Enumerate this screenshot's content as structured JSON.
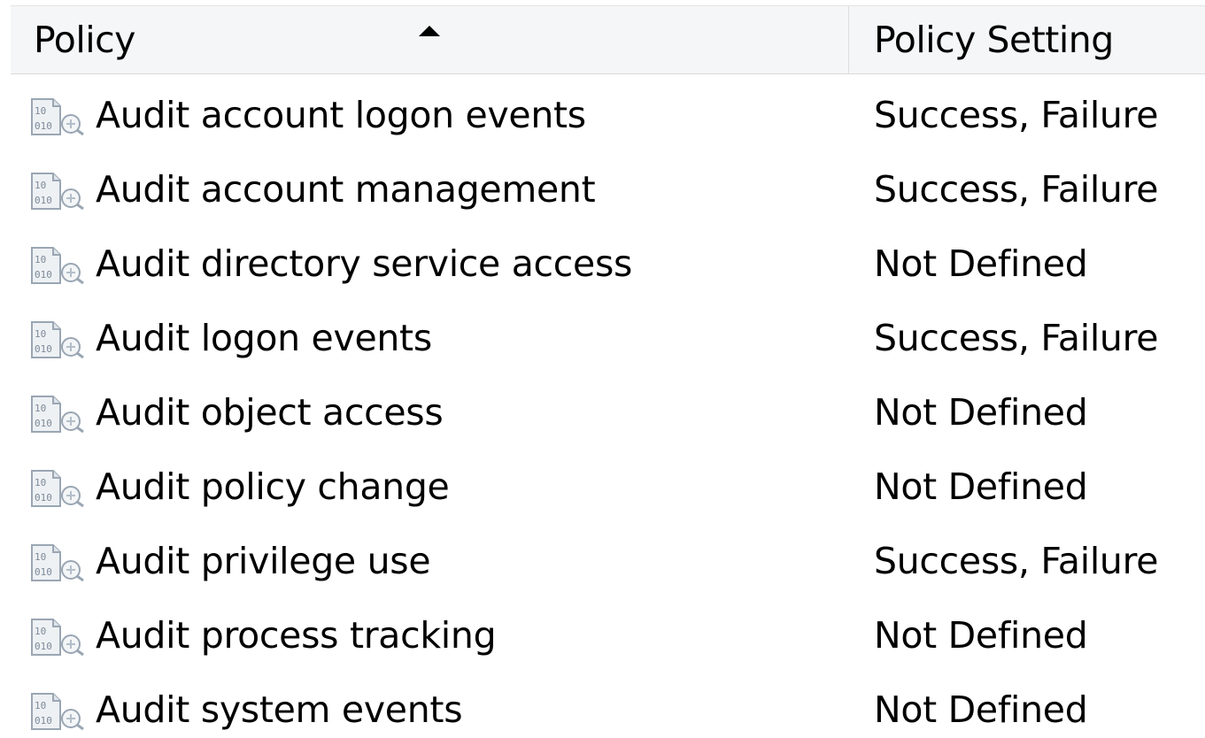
{
  "columns": {
    "policy": "Policy",
    "setting": "Policy Setting",
    "sort": "ascending"
  },
  "colors": {
    "header_bg": "#f5f6f7",
    "icon_paper": "#eef1f4",
    "icon_text": "#7d8a99"
  },
  "rows": [
    {
      "policy": "Audit account logon events",
      "setting": "Success, Failure",
      "icon": "policy-binary-icon"
    },
    {
      "policy": "Audit account management",
      "setting": "Success, Failure",
      "icon": "policy-binary-icon"
    },
    {
      "policy": "Audit directory service access",
      "setting": "Not Defined",
      "icon": "policy-binary-icon"
    },
    {
      "policy": "Audit logon events",
      "setting": "Success, Failure",
      "icon": "policy-binary-icon"
    },
    {
      "policy": "Audit object access",
      "setting": "Not Defined",
      "icon": "policy-binary-icon"
    },
    {
      "policy": "Audit policy change",
      "setting": "Not Defined",
      "icon": "policy-binary-icon"
    },
    {
      "policy": "Audit privilege use",
      "setting": "Success, Failure",
      "icon": "policy-binary-icon"
    },
    {
      "policy": "Audit process tracking",
      "setting": "Not Defined",
      "icon": "policy-binary-icon"
    },
    {
      "policy": "Audit system events",
      "setting": "Not Defined",
      "icon": "policy-binary-icon"
    }
  ]
}
